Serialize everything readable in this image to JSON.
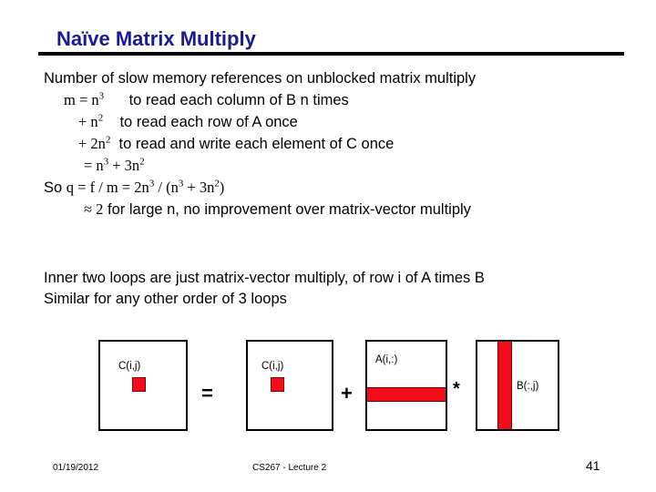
{
  "slide": {
    "title": "Naïve Matrix Multiply",
    "body_lines": [
      {
        "id": "l1",
        "indent": 0,
        "text": "Number of slow memory references on unblocked matrix multiply"
      },
      {
        "id": "l2",
        "indent": 1,
        "math_prefix": "m = n",
        "math_sup": "3",
        "text": "to read each column of B  n  times"
      },
      {
        "id": "l3",
        "indent": 2,
        "math_prefix": "+ n",
        "math_sup": "2",
        "text": "to read each row of A once"
      },
      {
        "id": "l4",
        "indent": 2,
        "math_prefix": "+ 2n",
        "math_sup": "2",
        "text": "to read and write each element of C once"
      },
      {
        "id": "l5",
        "indent": 3,
        "math_prefix": "= n",
        "math_sup": "3",
        "text": "+ 3n",
        "math_sup2": "2"
      },
      {
        "id": "l6",
        "indent": 0,
        "text": "So q = f / m = 2n3 / (n3 + 3n2)"
      },
      {
        "id": "l7",
        "indent": 4,
        "text": "≈ 2 for large n, no improvement over matrix-vector multiply"
      }
    ],
    "line1": "Number of slow memory references on unblocked matrix multiply",
    "line2_read": "to read each column of B  n  times",
    "line3_read": "to read each row of A once",
    "line4_read": "to read and write each element of C once",
    "line7_text": " for large n, no improvement over matrix-vector multiply",
    "paragraph2": [
      "Inner two loops are just matrix-vector multiply, of row i of A times B",
      "Similar for any other order of 3 loops"
    ]
  },
  "diagram": {
    "boxes": [
      {
        "name": "c-result",
        "label": "C(i,j)"
      },
      {
        "name": "c-operand",
        "label": "C(i,j)"
      },
      {
        "name": "a-operand",
        "label": "A(i,:)"
      },
      {
        "name": "b-operand",
        "label": "B(:,j)"
      }
    ],
    "operators": {
      "equals": "=",
      "plus": "+",
      "times": "*"
    },
    "colors": {
      "highlight": "#f20c1c",
      "border": "#000000"
    }
  },
  "footer": {
    "date": "01/19/2012",
    "course": "CS267 - Lecture 2",
    "page": "41"
  }
}
